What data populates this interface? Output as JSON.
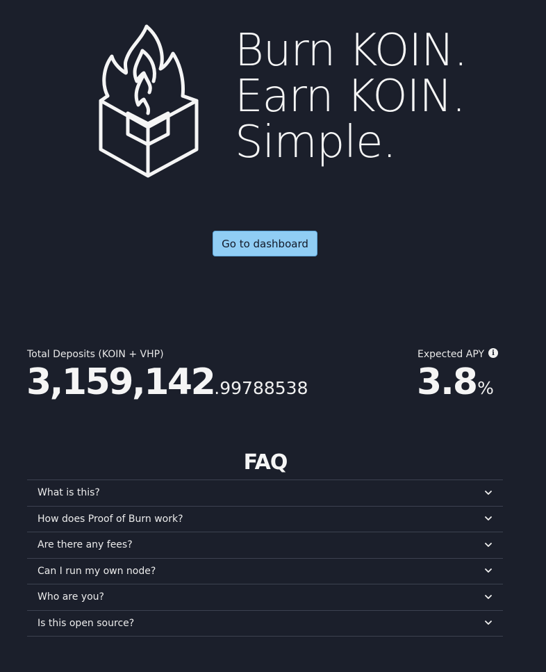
{
  "hero": {
    "line1": "Burn KOIN.",
    "line2": "Earn KOIN.",
    "line3": "Simple."
  },
  "cta": {
    "label": "Go to dashboard"
  },
  "stats": {
    "deposits": {
      "label": "Total Deposits (KOIN + VHP)",
      "integer": "3,159,142",
      "decimal": ".99788538"
    },
    "apy": {
      "label": "Expected APY",
      "value": "3.8",
      "unit": "%"
    }
  },
  "faq": {
    "title": "FAQ",
    "items": [
      {
        "question": "What is this?"
      },
      {
        "question": "How does Proof of Burn work?"
      },
      {
        "question": "Are there any fees?"
      },
      {
        "question": "Can I run my own node?"
      },
      {
        "question": "Who are you?"
      },
      {
        "question": "Is this open source?"
      }
    ]
  },
  "colors": {
    "background": "#1b1f2b",
    "button": "#90cdf4",
    "text": "#f2f2f2",
    "divider": "#3d4250"
  }
}
